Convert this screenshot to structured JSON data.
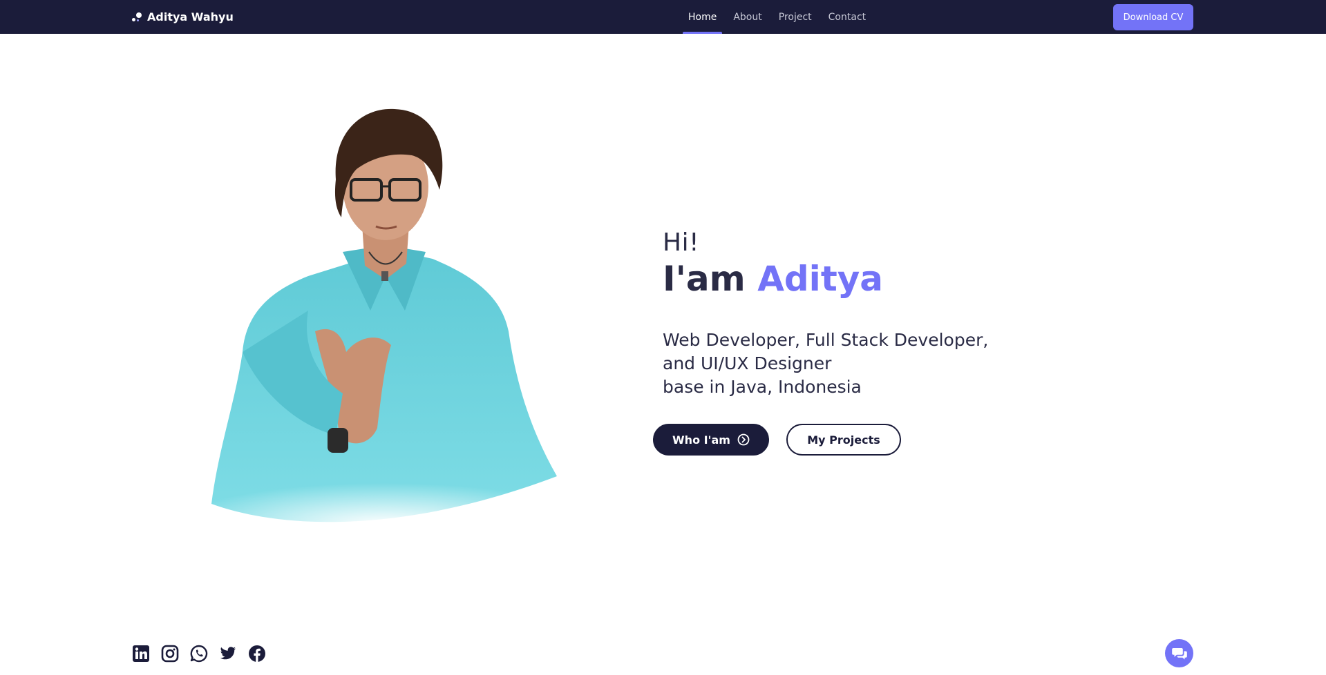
{
  "navbar": {
    "brand": "Aditya Wahyu",
    "links": [
      {
        "label": "Home",
        "active": true
      },
      {
        "label": "About",
        "active": false
      },
      {
        "label": "Project",
        "active": false
      },
      {
        "label": "Contact",
        "active": false
      }
    ],
    "download_label": "Download CV"
  },
  "hero": {
    "greeting": "Hi!",
    "iam_prefix": "I'am",
    "name": "Aditya",
    "desc_lines": [
      "Web Developer, Full Stack Developer,",
      "and UI/UX Designer",
      "base in Java, Indonesia"
    ],
    "primary_button": "Who I'am",
    "secondary_button": "My Projects"
  },
  "socials": [
    "linkedin-icon",
    "instagram-icon",
    "whatsapp-icon",
    "twitter-icon",
    "facebook-icon"
  ],
  "chat_icon": "chat-bubbles-icon",
  "colors": {
    "navbar": "#1b1c3a",
    "accent": "#7373f7",
    "text": "#2a2b45",
    "shirt": "#6fd6e0"
  }
}
